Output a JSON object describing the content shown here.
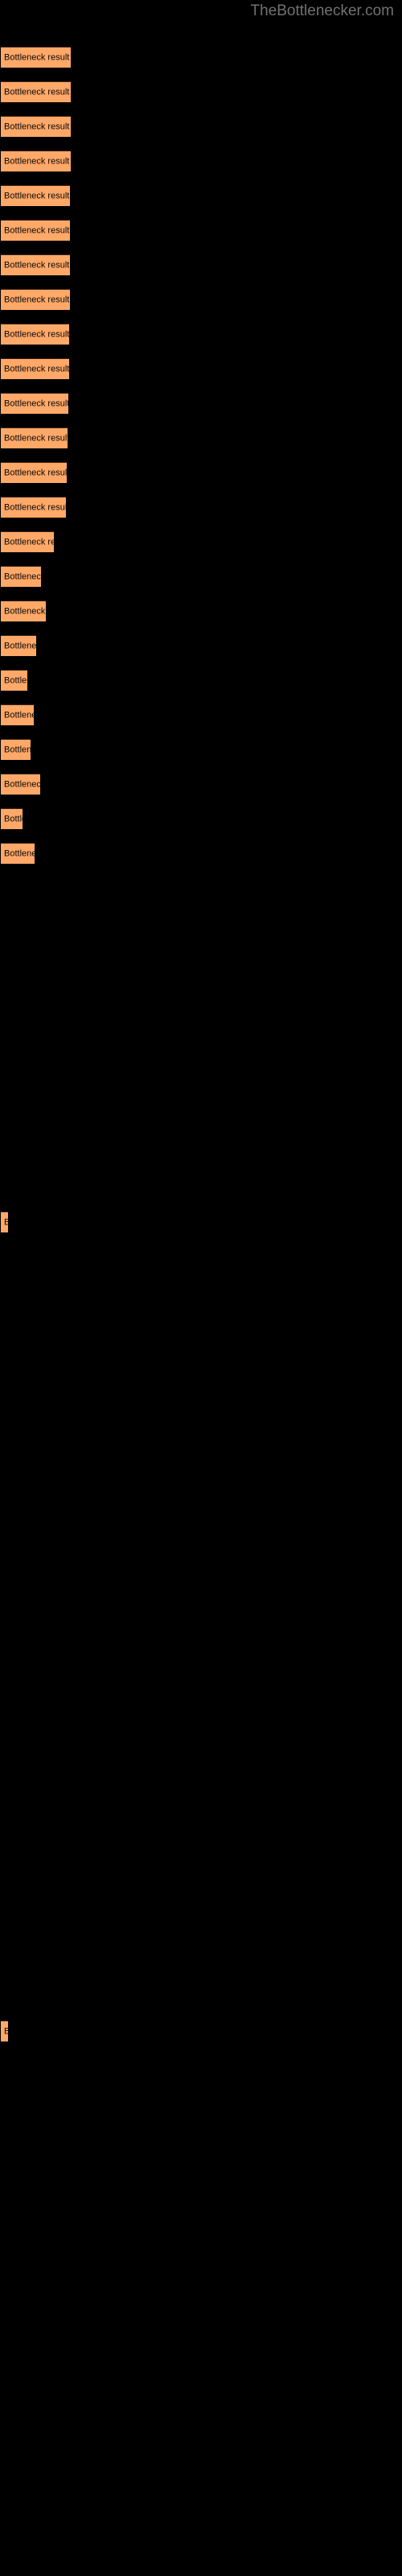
{
  "header": {
    "site_title": "TheBottlenecker.com"
  },
  "colors": {
    "background": "#000000",
    "bar_fill": "#ffa868",
    "bar_border": "#3a2416",
    "bar_label_text": "#0a0a0a",
    "site_title_text": "#717171"
  },
  "chart_data": {
    "type": "bar",
    "orientation": "horizontal",
    "title": "TheBottlenecker.com",
    "xlabel": "",
    "ylabel": "",
    "grid": false,
    "legend": null,
    "bar_label": "Bottleneck result",
    "categories": [
      "Bottleneck result",
      "Bottleneck result",
      "Bottleneck result",
      "Bottleneck result",
      "Bottleneck result",
      "Bottleneck result",
      "Bottleneck result",
      "Bottleneck result",
      "Bottleneck result",
      "Bottleneck result",
      "Bottleneck result",
      "Bottleneck result",
      "Bottleneck result",
      "Bottleneck result",
      "Bottleneck result",
      "Bottleneck result",
      "Bottleneck result",
      "Bottleneck result",
      "Bottleneck result",
      "Bottleneck result",
      "Bottleneck result",
      "Bottleneck result",
      "Bottleneck result",
      "Bottleneck result",
      "Bottleneck result",
      "Bottleneck result"
    ],
    "values": [
      87,
      87,
      87,
      87,
      86,
      86,
      86,
      86,
      85,
      85,
      84,
      83,
      82,
      81,
      66,
      50,
      56,
      44,
      33,
      41,
      37,
      49,
      27,
      42,
      9,
      9
    ],
    "xlim": [
      0,
      500
    ],
    "ylim": [
      0,
      26
    ]
  },
  "bars": [
    {
      "label": "Bottleneck result",
      "width": 87,
      "top": 58
    },
    {
      "label": "Bottleneck result",
      "width": 87,
      "top": 101
    },
    {
      "label": "Bottleneck result",
      "width": 87,
      "top": 144
    },
    {
      "label": "Bottleneck result",
      "width": 87,
      "top": 187
    },
    {
      "label": "Bottleneck result",
      "width": 86,
      "top": 230
    },
    {
      "label": "Bottleneck result",
      "width": 86,
      "top": 273
    },
    {
      "label": "Bottleneck result",
      "width": 86,
      "top": 316
    },
    {
      "label": "Bottleneck result",
      "width": 86,
      "top": 359
    },
    {
      "label": "Bottleneck result",
      "width": 85,
      "top": 402
    },
    {
      "label": "Bottleneck result",
      "width": 85,
      "top": 445
    },
    {
      "label": "Bottleneck result",
      "width": 84,
      "top": 488
    },
    {
      "label": "Bottleneck result",
      "width": 83,
      "top": 531
    },
    {
      "label": "Bottleneck result",
      "width": 82,
      "top": 574
    },
    {
      "label": "Bottleneck result",
      "width": 81,
      "top": 617
    },
    {
      "label": "Bottleneck result",
      "width": 66,
      "top": 660
    },
    {
      "label": "Bottleneck result",
      "width": 50,
      "top": 703
    },
    {
      "label": "Bottleneck result",
      "width": 56,
      "top": 746
    },
    {
      "label": "Bottleneck result",
      "width": 44,
      "top": 789
    },
    {
      "label": "Bottleneck result",
      "width": 33,
      "top": 832
    },
    {
      "label": "Bottleneck result",
      "width": 41,
      "top": 875
    },
    {
      "label": "Bottleneck result",
      "width": 37,
      "top": 918
    },
    {
      "label": "Bottleneck result",
      "width": 49,
      "top": 961
    },
    {
      "label": "Bottleneck result",
      "width": 27,
      "top": 1004
    },
    {
      "label": "Bottleneck result",
      "width": 42,
      "top": 1047
    },
    {
      "label": "Bottleneck result",
      "width": 9,
      "top": 1505
    },
    {
      "label": "Bottleneck result",
      "width": 9,
      "top": 2510
    }
  ]
}
